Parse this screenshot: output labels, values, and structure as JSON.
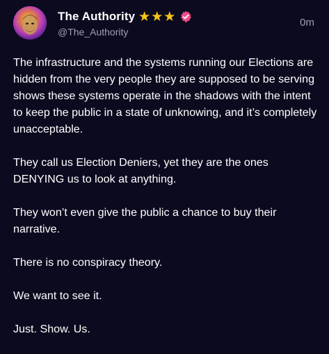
{
  "post": {
    "author": {
      "display_name": "The Authority",
      "handle": "@The_Authority",
      "star_count": 3,
      "verified": true
    },
    "timestamp": "0m",
    "paragraphs": [
      "The infrastructure and the systems running our Elections are hidden from the very people they are supposed to be serving shows these systems operate in the shadows with the intent to keep the public in a state of unknowing, and it’s completely unacceptable.",
      "They call us Election Deniers, yet they are the ones DENYING us to look at anything.",
      "They won’t even give the public a chance to buy their narrative.",
      "There is no conspiracy theory.",
      "We want to see it.",
      "Just. Show. Us."
    ]
  },
  "icons": {
    "star": "star-icon",
    "verified": "verified-badge-icon"
  },
  "colors": {
    "background": "#0c0a1f",
    "text": "#ffffff",
    "muted": "#9ea0b4",
    "star": "#f5c518",
    "verified": "#f04a86"
  }
}
